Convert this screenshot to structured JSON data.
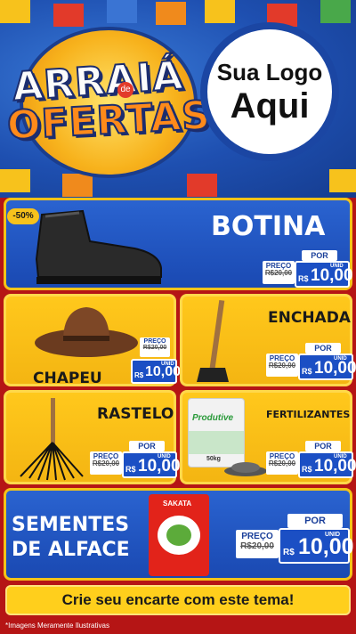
{
  "header": {
    "title_line1": "ARRAIÁ",
    "title_de": "de",
    "title_line2": "OFERTAS",
    "logo_line1": "Sua Logo",
    "logo_line2": "Aqui"
  },
  "products": {
    "botina": {
      "name": "BOTINA",
      "discount": "-50%",
      "preco": "PREÇO",
      "old": "R$20,00",
      "por": "POR",
      "currency": "R$",
      "price": "10,00",
      "unid": "UNID"
    },
    "chapeu": {
      "name": "CHAPEU",
      "preco": "PREÇO",
      "old": "R$20,00",
      "por": "POR",
      "currency": "R$",
      "price": "10,00",
      "unid": "UNID"
    },
    "enchada": {
      "name": "ENCHADA",
      "preco": "PREÇO",
      "old": "R$20,00",
      "por": "POR",
      "currency": "R$",
      "price": "10,00",
      "unid": "UNID"
    },
    "rastelo": {
      "name": "RASTELO",
      "preco": "PREÇO",
      "old": "R$20,00",
      "por": "POR",
      "currency": "R$",
      "price": "10,00",
      "unid": "UNID"
    },
    "fertilizantes": {
      "name": "FERTILIZANTES",
      "bag_brand": "Produtive",
      "bag_weight": "50kg",
      "preco": "PREÇO",
      "old": "R$20,00",
      "por": "POR",
      "currency": "R$",
      "price": "10,00",
      "unid": "UNID"
    },
    "sementes": {
      "name_line1": "SEMENTES",
      "name_line2": "DE ALFACE",
      "pack_brand": "SAKATA",
      "preco": "PREÇO",
      "old": "R$20,00",
      "por": "POR",
      "currency": "R$",
      "price": "10,00",
      "unid": "UNID"
    }
  },
  "banner": "Crie seu encarte com este tema!",
  "footnote": "*Imagens Meramente Ilustrativas",
  "colors": {
    "background": "#b51515",
    "panel_blue": "#1a49b2",
    "panel_yellow": "#f4b512",
    "accent_yellow": "#f7c21c"
  }
}
